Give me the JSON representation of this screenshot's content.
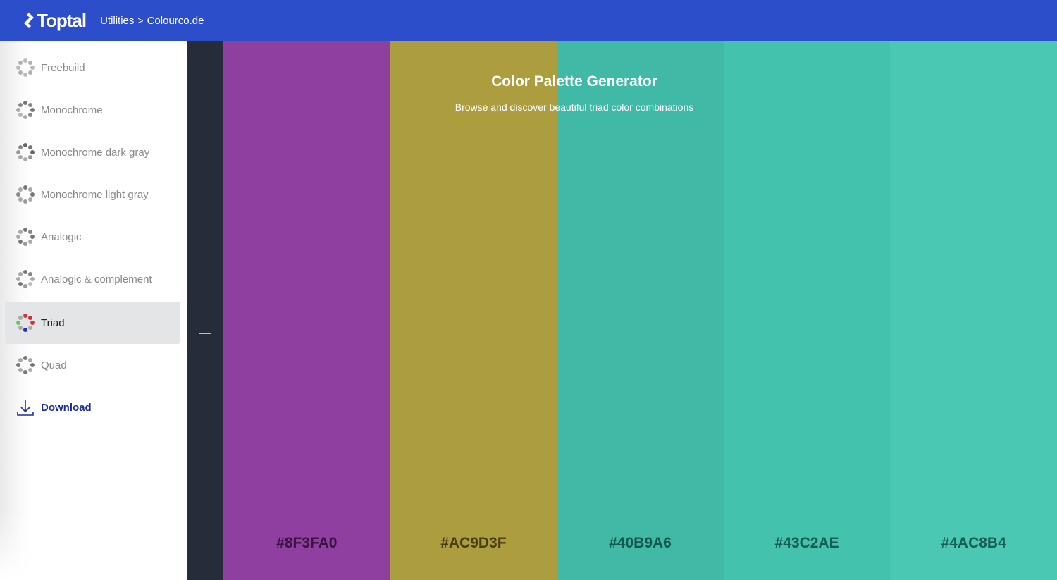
{
  "header": {
    "logo_text": "Toptal",
    "breadcrumb": [
      "Utilities",
      "Colourco.de"
    ],
    "breadcrumb_separator": ">"
  },
  "sidebar": {
    "items": [
      {
        "label": "Freebuild",
        "icon": "freebuild-dots-icon",
        "active": false
      },
      {
        "label": "Monochrome",
        "icon": "monochrome-dots-icon",
        "active": false
      },
      {
        "label": "Monochrome dark gray",
        "icon": "monochrome-dark-gray-dots-icon",
        "active": false
      },
      {
        "label": "Monochrome light gray",
        "icon": "monochrome-light-gray-dots-icon",
        "active": false
      },
      {
        "label": "Analogic",
        "icon": "analogic-dots-icon",
        "active": false
      },
      {
        "label": "Analogic & complement",
        "icon": "analogic-complement-dots-icon",
        "active": false
      },
      {
        "label": "Triad",
        "icon": "triad-dots-icon",
        "active": true
      },
      {
        "label": "Quad",
        "icon": "quad-dots-icon",
        "active": false
      }
    ],
    "download_label": "Download"
  },
  "hero": {
    "title": "Color Palette Generator",
    "subtitle": "Browse and discover beautiful triad color combinations"
  },
  "palette": [
    {
      "hex": "#8F3FA0",
      "label": "#8F3FA0",
      "text_color": "#3a1342"
    },
    {
      "hex": "#AC9D3F",
      "label": "#AC9D3F",
      "text_color": "#463f12"
    },
    {
      "hex": "#40B9A6",
      "label": "#40B9A6",
      "text_color": "#15574c"
    },
    {
      "hex": "#43C2AE",
      "label": "#43C2AE",
      "text_color": "#175c51"
    },
    {
      "hex": "#4AC8B4",
      "label": "#4AC8B4",
      "text_color": "#1a5e53"
    }
  ],
  "colors": {
    "header_bg": "#2d4ecb",
    "strip_bg": "#262c3a",
    "download_color": "#1b2ea0"
  }
}
